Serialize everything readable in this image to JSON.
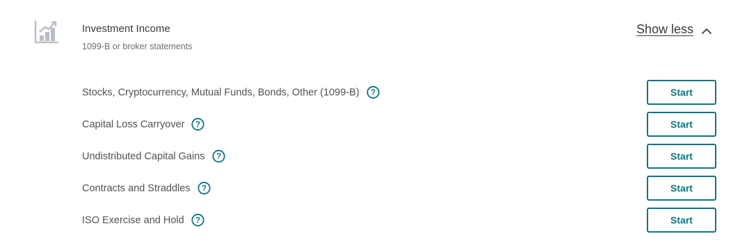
{
  "section": {
    "icon": "investment-chart-icon",
    "title": "Investment Income",
    "subtitle": "1099-B or broker statements",
    "toggle_label": "Show less",
    "toggle_icon": "chevron-up-icon"
  },
  "rows": [
    {
      "label": "Stocks, Cryptocurrency, Mutual Funds, Bonds, Other (1099-B)",
      "button": "Start"
    },
    {
      "label": "Capital Loss Carryover",
      "button": "Start"
    },
    {
      "label": "Undistributed Capital Gains",
      "button": "Start"
    },
    {
      "label": "Contracts and Straddles",
      "button": "Start"
    },
    {
      "label": "ISO Exercise and Hold",
      "button": "Start"
    }
  ],
  "colors": {
    "accent": "#0d7580",
    "text": "#393a3d",
    "muted_text": "#6b6c72",
    "icon_gray": "#babec5"
  }
}
